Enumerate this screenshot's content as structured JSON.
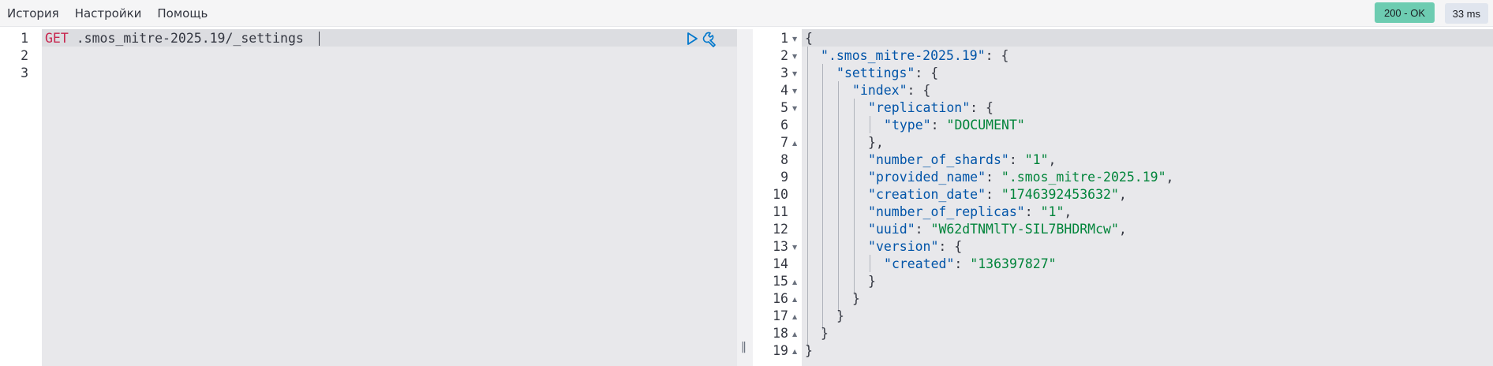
{
  "menu": {
    "history": "История",
    "settings": "Настройки",
    "help": "Помощь"
  },
  "status": {
    "code": "200 - OK",
    "time": "33 ms"
  },
  "request": {
    "line_numbers": [
      "1",
      "2",
      "3"
    ],
    "method": "GET",
    "path": ".smos_mitre-2025.19/_settings"
  },
  "response": {
    "line_numbers": [
      "1",
      "2",
      "3",
      "4",
      "5",
      "6",
      "7",
      "8",
      "9",
      "10",
      "11",
      "12",
      "13",
      "14",
      "15",
      "16",
      "17",
      "18",
      "19"
    ],
    "index_name": ".smos_mitre-2025.19",
    "settings_key": "settings",
    "index_key": "index",
    "replication_key": "replication",
    "type_key": "type",
    "type_value": "DOCUMENT",
    "shards_key": "number_of_shards",
    "shards_value": "1",
    "provided_name_key": "provided_name",
    "provided_name_value": ".smos_mitre-2025.19",
    "creation_date_key": "creation_date",
    "creation_date_value": "1746392453632",
    "replicas_key": "number_of_replicas",
    "replicas_value": "1",
    "uuid_key": "uuid",
    "uuid_value": "W62dTNMlTY-SIL7BHDRMcw",
    "version_key": "version",
    "created_key": "created",
    "created_value": "136397827"
  },
  "icons": [
    "play-icon",
    "wrench-icon",
    "fold-arrow-icon",
    "resize-handle-icon"
  ],
  "colors": {
    "status_ok": "#6dccb1",
    "editor_bg": "#e8e8eb",
    "string": "#00843a",
    "key": "#0054a8",
    "method": "#c7254e"
  }
}
